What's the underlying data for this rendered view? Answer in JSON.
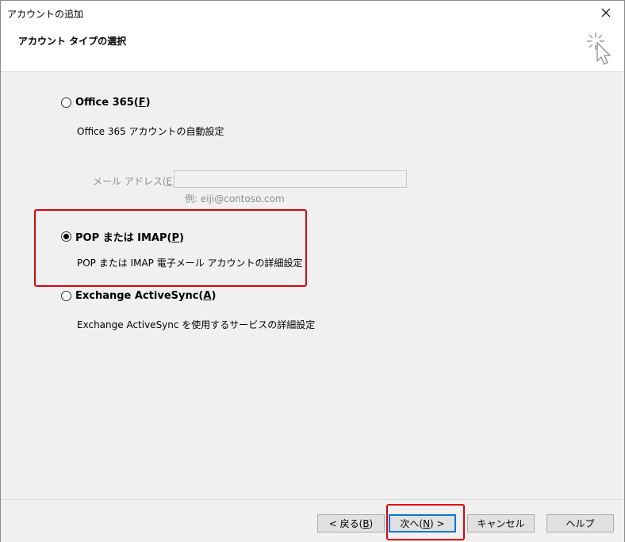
{
  "window": {
    "title": "アカウントの追加"
  },
  "header": {
    "title": "アカウント タイプの選択",
    "icon": "sparkle-cursor-icon"
  },
  "options": [
    {
      "label_main": "Office 365(",
      "label_key": "F",
      "label_end": ")",
      "description": "Office 365 アカウントの自動設定",
      "selected": false
    },
    {
      "label_main": "POP または IMAP(",
      "label_key": "P",
      "label_end": ")",
      "description": "POP または IMAP 電子メール アカウントの詳細設定",
      "selected": true
    },
    {
      "label_main": "Exchange ActiveSync(",
      "label_key": "A",
      "label_end": ")",
      "description": "Exchange ActiveSync を使用するサービスの詳細設定",
      "selected": false
    }
  ],
  "email": {
    "label_main": "メール アドレス(",
    "label_key": "E",
    "label_end": "):",
    "value": "",
    "example": "例: eiji@contoso.com"
  },
  "buttons": {
    "back_main": "< 戻る(",
    "back_key": "B",
    "back_end": ")",
    "next_main": "次へ(",
    "next_key": "N",
    "next_end": ") >",
    "cancel": "キャンセル",
    "help": "ヘルプ"
  },
  "colors": {
    "highlight": "#e0000a",
    "default_button_border": "#0078d7"
  }
}
